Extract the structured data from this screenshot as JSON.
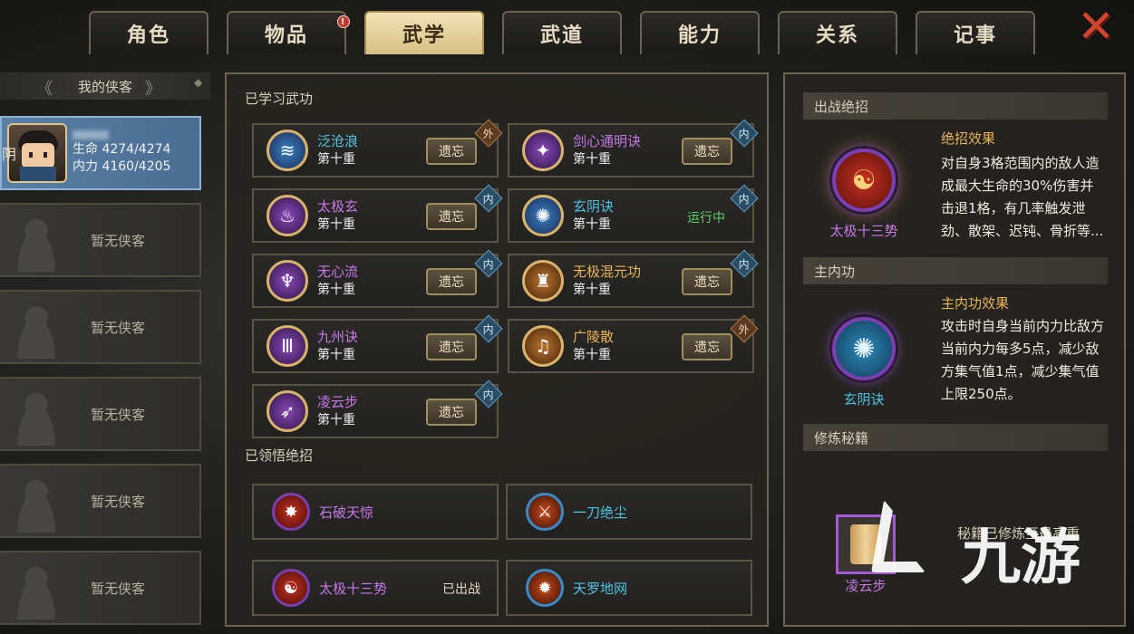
{
  "tabs": [
    {
      "label": "角色",
      "active": false,
      "alert": false
    },
    {
      "label": "物品",
      "active": false,
      "alert": true
    },
    {
      "label": "武学",
      "active": true,
      "alert": false
    },
    {
      "label": "武道",
      "active": false,
      "alert": false
    },
    {
      "label": "能力",
      "active": false,
      "alert": false
    },
    {
      "label": "关系",
      "active": false,
      "alert": false
    },
    {
      "label": "记事",
      "active": false,
      "alert": false
    }
  ],
  "alert_mark": "!",
  "close_icon": "close-x-icon",
  "sidebar": {
    "title": "我的侠客",
    "active_hero": {
      "hp_label": "生命",
      "hp": "4274/4274",
      "mp_label": "内力",
      "mp": "4160/4205",
      "attribute": "阴"
    },
    "empty_label": "暂无侠客"
  },
  "learned": {
    "title": "已学习武功",
    "forget_label": "遗忘",
    "running_label": "运行中",
    "skills": [
      {
        "name": "泛沧浪",
        "level": "第十重",
        "tag": "外",
        "color": "#4fc5e4",
        "icon": "claw-wave-icon",
        "state": "forget"
      },
      {
        "name": "剑心通明诀",
        "level": "第十重",
        "tag": "内",
        "color": "#c679e8",
        "icon": "sword-heart-icon",
        "state": "forget"
      },
      {
        "name": "太极玄",
        "level": "第十重",
        "tag": "内",
        "color": "#c679e8",
        "icon": "taiji-flame-icon",
        "state": "forget"
      },
      {
        "name": "玄阴诀",
        "level": "第十重",
        "tag": "内",
        "color": "#4fc5e4",
        "icon": "yin-orb-icon",
        "state": "running"
      },
      {
        "name": "无心流",
        "level": "第十重",
        "tag": "内",
        "color": "#c679e8",
        "icon": "blue-flame-icon",
        "state": "forget"
      },
      {
        "name": "无极混元功",
        "level": "第十重",
        "tag": "内",
        "color": "#e8b457",
        "icon": "pillar-icon",
        "state": "forget"
      },
      {
        "name": "九州诀",
        "level": "第十重",
        "tag": "内",
        "color": "#c679e8",
        "icon": "pillars-icon",
        "state": "forget"
      },
      {
        "name": "广陵散",
        "level": "第十重",
        "tag": "外",
        "color": "#e8b457",
        "icon": "lute-icon",
        "state": "forget"
      },
      {
        "name": "凌云步",
        "level": "第十重",
        "tag": "内",
        "color": "#c679e8",
        "icon": "wing-step-icon",
        "state": "forget"
      }
    ]
  },
  "ultimates": {
    "title": "已领悟绝招",
    "deployed_label": "已出战",
    "items": [
      {
        "name": "石破天惊",
        "color": "#c679e8",
        "icon": "burst-icon",
        "deployed": false
      },
      {
        "name": "一刀绝尘",
        "color": "#4fc5e4",
        "icon": "blade-icon",
        "deployed": false
      },
      {
        "name": "太极十三势",
        "color": "#c679e8",
        "icon": "taiji-icon",
        "deployed": true
      },
      {
        "name": "天罗地网",
        "color": "#4fc5e4",
        "icon": "net-icon",
        "deployed": false
      }
    ]
  },
  "right": {
    "battle_title": "出战绝招",
    "battle_skill": "太极十三势",
    "battle_effect_title": "绝招效果",
    "battle_effect": "对自身3格范围内的敌人造成最大生命的30%伤害并击退1格，有几率触发泄劲、散架、迟钝、骨折等...",
    "inner_title": "主内功",
    "inner_skill": "玄阴诀",
    "inner_effect_title": "主内功效果",
    "inner_effect": "攻击时自身当前内力比敌方当前内力每多5点，减少敌方集气值1点，减少集气值上限250点。",
    "manual_title": "修炼秘籍",
    "manual_skill": "凌云步",
    "manual_status": "秘籍已修炼至最高重"
  },
  "watermark": "九游"
}
